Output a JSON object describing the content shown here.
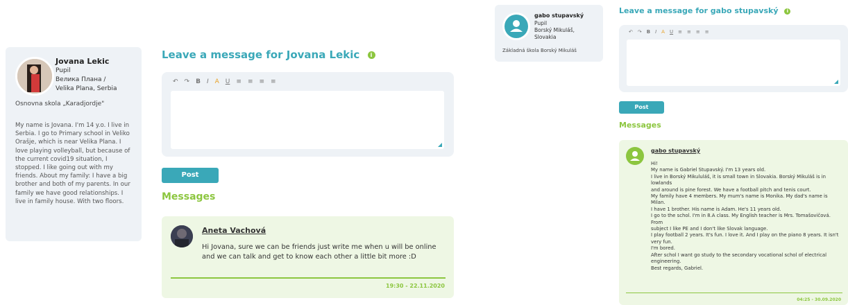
{
  "left_profile": {
    "name": "Jovana Lekic",
    "role": "Pupil",
    "location_line1": "Велика Плана /",
    "location_line2": "Velika Plana, Serbia",
    "school": "Osnovna skola „Karadjordje\"",
    "bio": "My name is Jovana. I'm 14 y.o. I live in Serbia. I go to Primary school in Veliko Orašje, which is near Velika Plana. I love playing volleyball, but because of the current covid19 situation, I stopped. I like going out with my friends. About my family: I have a big brother and both of my parents. In our family we have good relationships. I live in family house. With two floors."
  },
  "center": {
    "heading": "Leave a message for Jovana Lekic",
    "post_label": "Post",
    "messages_heading": "Messages",
    "message": {
      "author": "Aneta Vachová",
      "text": "Hi Jovana, sure we can be friends just write me when u will be online and we can talk and get to know each other a little bit more :D",
      "timestamp": "19:30 - 22.11.2020"
    }
  },
  "right_profile": {
    "name": "gabo stupavský",
    "role": "Pupil",
    "location_line1": "Borský Mikuláš,",
    "location_line2": "Slovakia",
    "school": "Základná škola Borský Mikuláš"
  },
  "right": {
    "heading": "Leave a message for gabo stupavský",
    "post_label": "Post",
    "messages_heading": "Messages",
    "message": {
      "author": "gabo stupavský",
      "text": "Hi!\nMy name is Gabriel Stupavský. I'm 13 years old.\nI live in Borský Mikululáš, it is small town in Slovakia. Borský Mikuláš is in lowlands\nand around is pine forest. We have a football pitch and tenis court.\nMy family have 4 members. My mum's name is Monika. My dad's name is Milan.\nI have 1 brother. His name is Adam. He's 11 years old.\nI go to the schol. I'm in 8.A class. My English teacher is Mrs. Tomašovičová. From\nsubject I like PE and I don't like Slovak language.\nI play football 2 years. It's fun. I love it. And I play on the piano 8 years. It isn't very fun.\nI'm bored.\nAfter schol I want go study to the secondary vocational schol of electrical engineering.\nBest regards, Gabriel.",
      "timestamp": "04:25 - 30.09.2020"
    }
  },
  "icons": {
    "info": "info-icon",
    "undo": "undo-icon",
    "redo": "redo-icon",
    "bold": "bold-icon",
    "italic": "italic-icon",
    "color": "text-color-icon",
    "underline": "underline-icon",
    "align_left": "align-left-icon",
    "align_center": "align-center-icon",
    "align_right": "align-right-icon",
    "justify": "justify-icon"
  },
  "colors": {
    "teal": "#3aa8b8",
    "green": "#8cc63f",
    "card": "#eef2f6",
    "msg_bg": "#eef7e4"
  }
}
